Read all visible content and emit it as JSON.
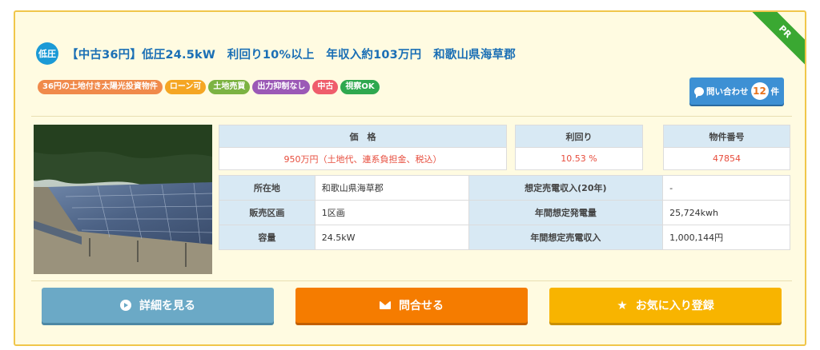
{
  "card": {
    "pr_label": "PR"
  },
  "header": {
    "type_badge": "低圧",
    "title": "【中古36円】低圧24.5kW　利回り10%以上　年収入約103万円　和歌山県海草郡"
  },
  "tags": [
    {
      "label": "36円の土地付き太陽光投資物件",
      "color": "#f08a4b"
    },
    {
      "label": "ローン可",
      "color": "#f5a623"
    },
    {
      "label": "土地売買",
      "color": "#7cb342"
    },
    {
      "label": "出力抑制なし",
      "color": "#9b59b6"
    },
    {
      "label": "中古",
      "color": "#ef5d6b"
    },
    {
      "label": "視察OK",
      "color": "#2fa84f"
    }
  ],
  "inquiry": {
    "label": "問い合わせ",
    "count": "12",
    "suffix": "件"
  },
  "summary": {
    "price_header": "価　格",
    "price_value": "950万円（土地代、連系負担金、税込）",
    "yield_header": "利回り",
    "yield_value": "10.53 %",
    "id_header": "物件番号",
    "id_value": "47854"
  },
  "details": {
    "rows": [
      {
        "label1": "所在地",
        "value1": "和歌山県海草郡",
        "label2": "想定売電収入(20年)",
        "value2": "-"
      },
      {
        "label1": "販売区画",
        "value1": "1区画",
        "label2": "年間想定発電量",
        "value2": "25,724kwh"
      },
      {
        "label1": "容量",
        "value1": "24.5kW",
        "label2": "年間想定売電収入",
        "value2": "1,000,144円"
      }
    ]
  },
  "buttons": {
    "detail": "詳細を見る",
    "contact": "問合せる",
    "favorite": "お気に入り登録"
  },
  "icons": {
    "detail": "arrow-circle-icon",
    "contact": "mail-icon",
    "favorite": "star-icon",
    "inquiry": "chat-bubble-icon"
  }
}
